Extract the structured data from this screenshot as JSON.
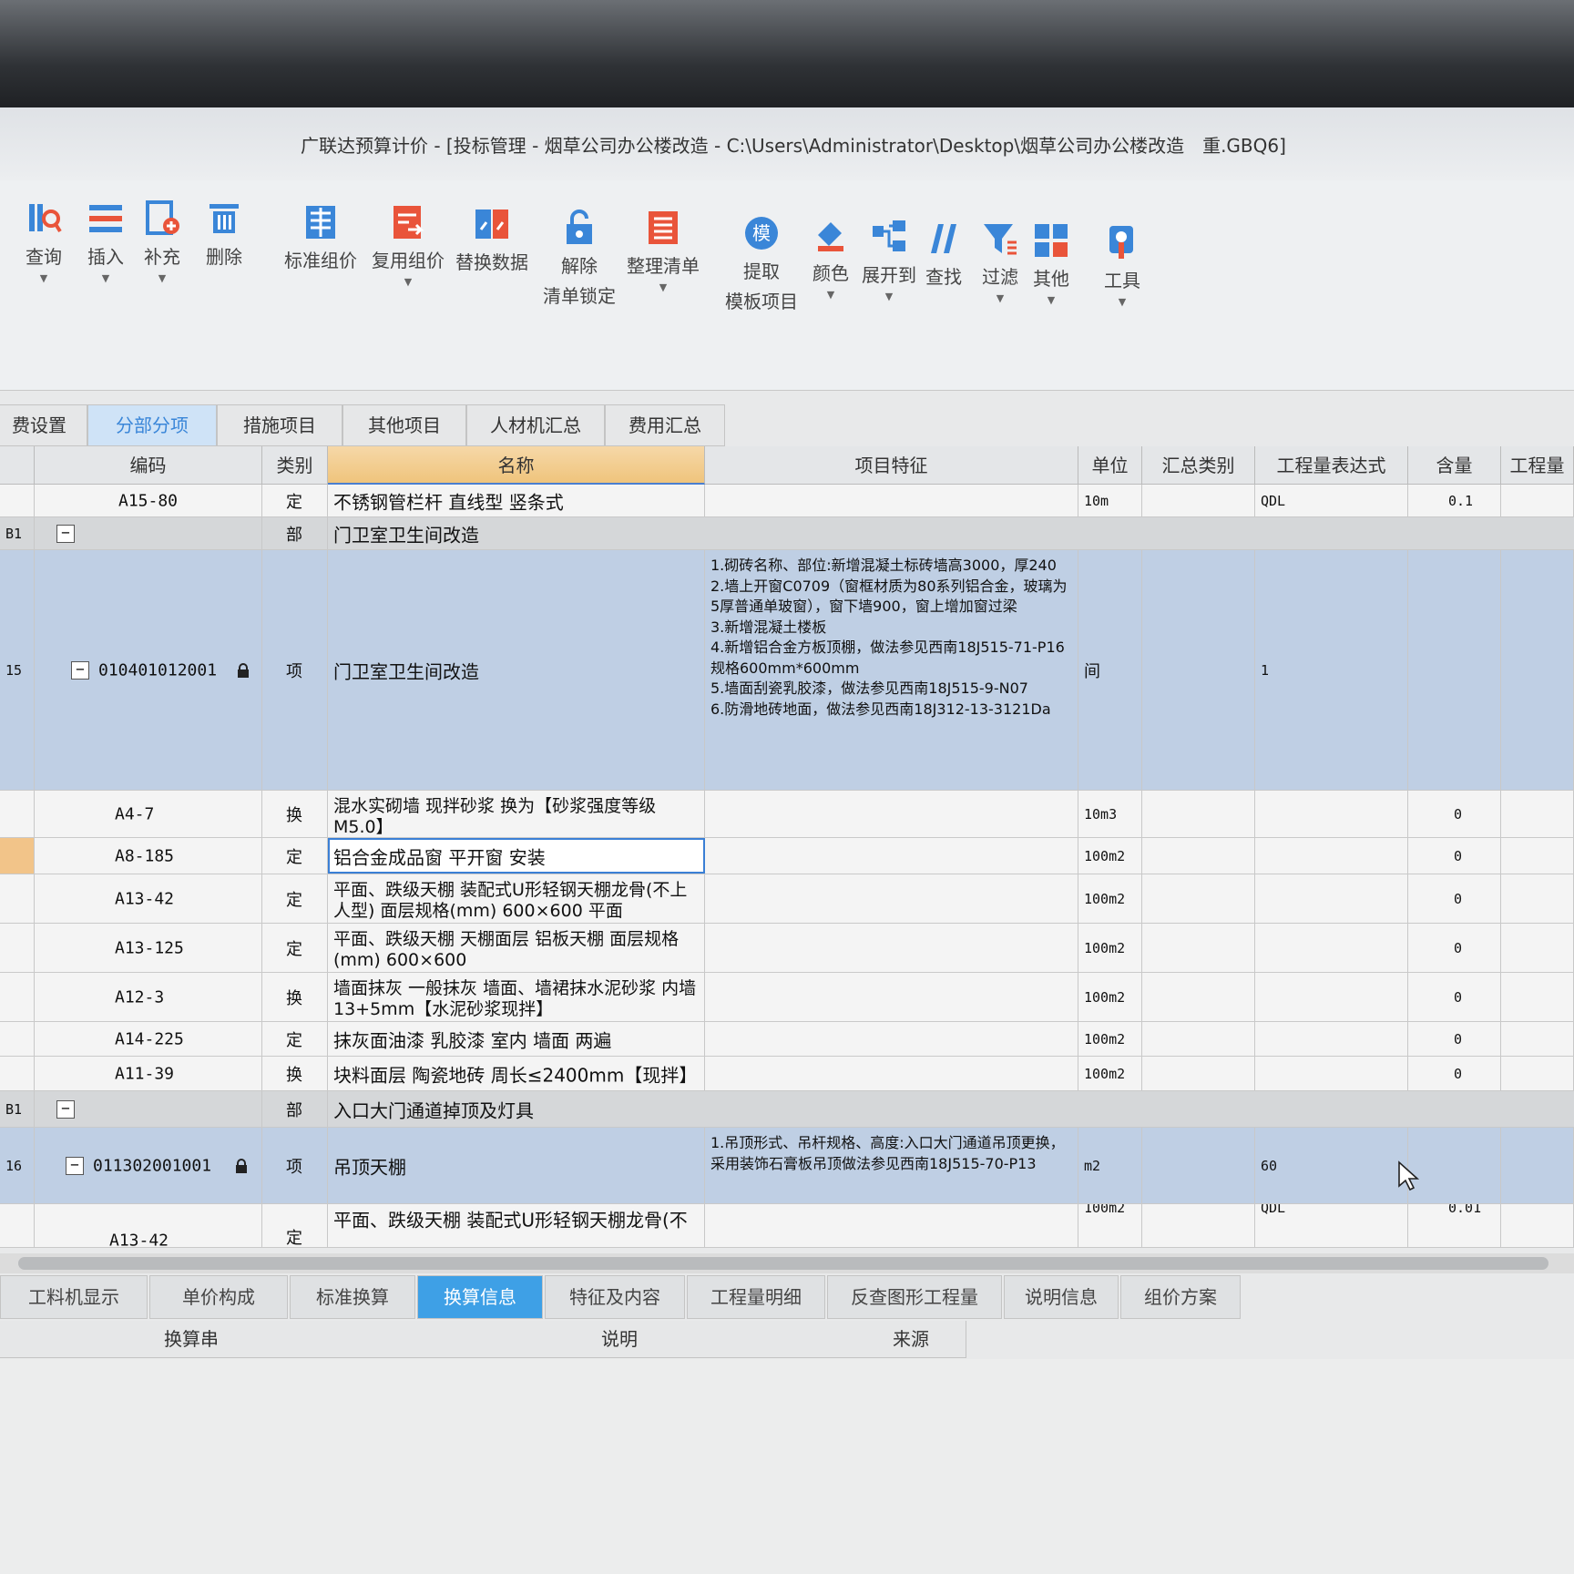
{
  "window": {
    "title": "广联达预算计价 - [投标管理 - 烟草公司办公楼改造 - C:\\Users\\Administrator\\Desktop\\烟草公司办公楼改造　重.GBQ6]"
  },
  "toolbar": [
    {
      "label": "查询",
      "icon": "query-icon",
      "caret": true
    },
    {
      "label": "插入",
      "icon": "insert-icon",
      "caret": true
    },
    {
      "label": "补充",
      "icon": "supplement-icon",
      "caret": true
    },
    {
      "label": "删除",
      "icon": "delete-icon",
      "caret": false
    },
    {
      "label": "标准组价",
      "icon": "standard-pricing-icon",
      "caret": false
    },
    {
      "label": "复用组价",
      "icon": "reuse-pricing-icon",
      "caret": true
    },
    {
      "label": "替换数据",
      "icon": "replace-data-icon",
      "caret": false
    },
    {
      "label": "解除",
      "label2": "清单锁定",
      "icon": "unlock-icon",
      "caret": false
    },
    {
      "label": "整理清单",
      "icon": "organize-list-icon",
      "caret": true
    },
    {
      "label": "提取",
      "label2": "模板项目",
      "icon": "template-icon",
      "icon_text": "模",
      "caret": false
    },
    {
      "label": "颜色",
      "icon": "color-icon",
      "caret": true
    },
    {
      "label": "展开到",
      "icon": "expand-icon",
      "caret": true
    },
    {
      "label": "查找",
      "icon": "find-icon",
      "caret": false
    },
    {
      "label": "过滤",
      "icon": "filter-icon",
      "caret": true
    },
    {
      "label": "其他",
      "icon": "other-icon",
      "caret": true
    },
    {
      "label": "工具",
      "icon": "tools-icon",
      "caret": true
    }
  ],
  "tabs": [
    "费设置",
    "分部分项",
    "措施项目",
    "其他项目",
    "人材机汇总",
    "费用汇总"
  ],
  "active_tab": "分部分项",
  "columns": [
    "编码",
    "类别",
    "名称",
    "项目特征",
    "单位",
    "汇总类别",
    "工程量表达式",
    "含量",
    "工程量"
  ],
  "rows": [
    {
      "num": "",
      "code": "A15-80",
      "type": "定",
      "name": "不锈钢管栏杆 直线型 竖条式",
      "feature": "",
      "unit": "10m",
      "expr": "QDL",
      "content": "0.1"
    },
    {
      "num": "B1",
      "code": "",
      "type": "部",
      "name": "门卫室卫生间改造",
      "feature": "",
      "unit": "",
      "expr": "",
      "content": ""
    },
    {
      "num": "15",
      "code": "010401012001",
      "type": "项",
      "name": "门卫室卫生间改造",
      "feature": "1.砌砖名称、部位:新增混凝土标砖墙高3000，厚240\n2.墙上开窗C0709（窗框材质为80系列铝合金，玻璃为5厚普通单玻窗），窗下墙900，窗上增加窗过梁\n3.新增混凝土楼板\n4.新增铝合金方板顶棚，做法参见西南18J515-71-P16规格600mm*600mm\n5.墙面刮瓷乳胶漆，做法参见西南18J515-9-N07\n6.防滑地砖地面，做法参见西南18J312-13-3121Da",
      "unit": "间",
      "expr": "1",
      "content": ""
    },
    {
      "num": "",
      "code": "A4-7",
      "type": "换",
      "name": "混水实砌墙 现拌砂浆  换为【砂浆强度等级M5.0】",
      "feature": "",
      "unit": "10m3",
      "expr": "",
      "content": "0"
    },
    {
      "num": "",
      "code": "A8-185",
      "type": "定",
      "name": "铝合金成品窗 平开窗 安装",
      "feature": "",
      "unit": "100m2",
      "expr": "",
      "content": "0"
    },
    {
      "num": "",
      "code": "A13-42",
      "type": "定",
      "name": "平面、跌级天棚 装配式U形轻钢天棚龙骨(不上人型) 面层规格(mm) 600×600 平面",
      "feature": "",
      "unit": "100m2",
      "expr": "",
      "content": "0"
    },
    {
      "num": "",
      "code": "A13-125",
      "type": "定",
      "name": "平面、跌级天棚 天棚面层 铝板天棚 面层规格(mm) 600×600",
      "feature": "",
      "unit": "100m2",
      "expr": "",
      "content": "0"
    },
    {
      "num": "",
      "code": "A12-3",
      "type": "换",
      "name": "墙面抹灰 一般抹灰 墙面、墙裙抹水泥砂浆 内墙 13+5mm【水泥砂浆现拌】",
      "feature": "",
      "unit": "100m2",
      "expr": "",
      "content": "0"
    },
    {
      "num": "",
      "code": "A14-225",
      "type": "定",
      "name": "抹灰面油漆 乳胶漆 室内 墙面 两遍",
      "feature": "",
      "unit": "100m2",
      "expr": "",
      "content": "0"
    },
    {
      "num": "",
      "code": "A11-39",
      "type": "换",
      "name": "块料面层 陶瓷地砖 周长≤2400mm【现拌】",
      "feature": "",
      "unit": "100m2",
      "expr": "",
      "content": "0"
    },
    {
      "num": "B1",
      "code": "",
      "type": "部",
      "name": "入口大门通道掉顶及灯具",
      "feature": "",
      "unit": "",
      "expr": "",
      "content": ""
    },
    {
      "num": "16",
      "code": "011302001001",
      "type": "项",
      "name": "吊顶天棚",
      "feature": "1.吊顶形式、吊杆规格、高度:入口大门通道吊顶更换，采用装饰石膏板吊顶做法参见西南18J515-70-P13",
      "unit": "m2",
      "expr": "60",
      "content": ""
    },
    {
      "num": "",
      "code": "A13-42",
      "type": "定",
      "name": "平面、跌级天棚 装配式U形轻钢天棚龙骨(不",
      "feature": "",
      "unit": "100m2",
      "expr": "QDL",
      "content": "0.01"
    }
  ],
  "bottom_tabs": [
    "工料机显示",
    "单价构成",
    "标准换算",
    "换算信息",
    "特征及内容",
    "工程量明细",
    "反查图形工程量",
    "说明信息",
    "组价方案"
  ],
  "active_bottom_tab": "换算信息",
  "bottom_columns": [
    "换算串",
    "说明",
    "来源"
  ],
  "colors": {
    "accent": "#3ea0e6",
    "selected_row": "#bfcfe4",
    "name_header": "#efc47c"
  }
}
